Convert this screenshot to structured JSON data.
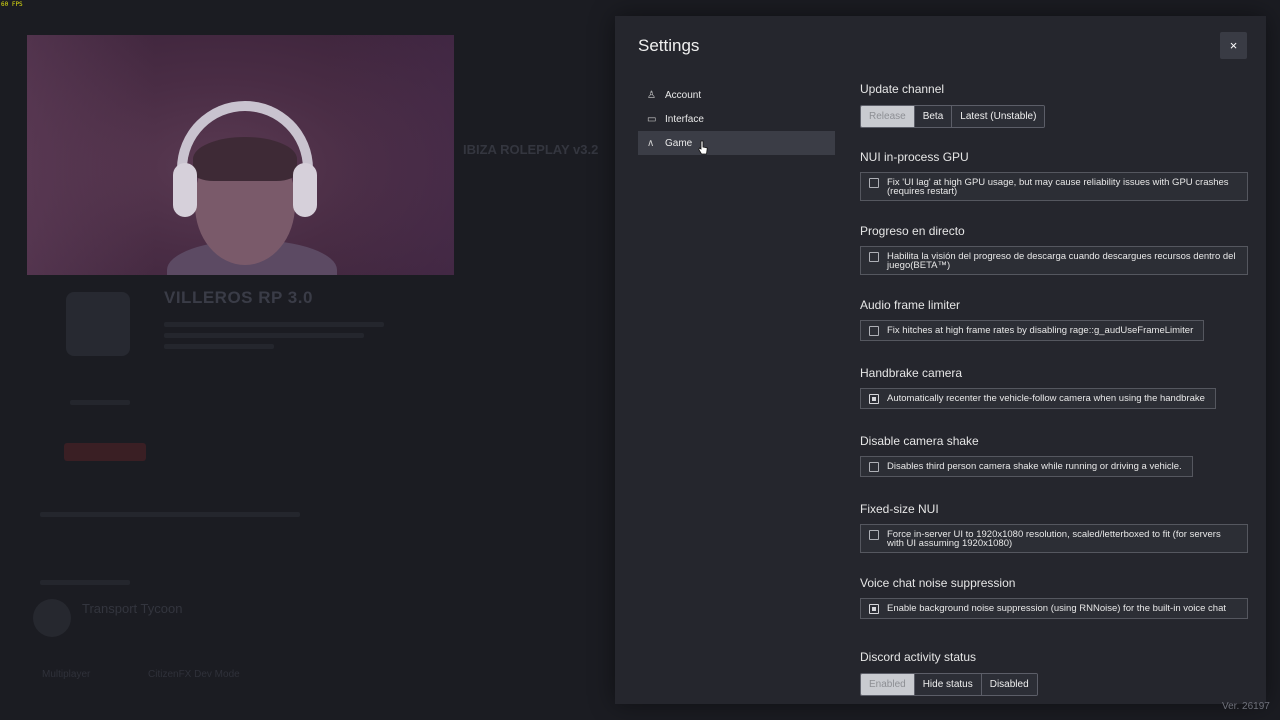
{
  "fps": "60 FPS",
  "background": {
    "server_title": "VILLEROS RP 3.0",
    "ibiza": "IBIZA ROLEPLAY v3.2",
    "transport": "Transport Tycoon",
    "footer_left": "Multiplayer",
    "footer_right": "CitizenFX Dev Mode"
  },
  "settings": {
    "title": "Settings",
    "close_icon": "×",
    "nav": [
      {
        "icon": "♙",
        "label": "Account"
      },
      {
        "icon": "▭",
        "label": "Interface"
      },
      {
        "icon": "∧",
        "label": "Game"
      }
    ],
    "update_channel": {
      "title": "Update channel",
      "options": [
        "Release",
        "Beta",
        "Latest (Unstable)"
      ],
      "selected": "Release"
    },
    "nui_gpu": {
      "title": "NUI in-process GPU",
      "text": "Fix 'UI lag' at high GPU usage, but may cause reliability issues with GPU crashes (requires restart)",
      "checked": false
    },
    "progreso": {
      "title": "Progreso en directo",
      "text": "Habilita la visión del progreso de descarga cuando descargues recursos dentro del juego(BETA™)",
      "checked": false
    },
    "audio": {
      "title": "Audio frame limiter",
      "text": "Fix hitches at high frame rates by disabling rage::g_audUseFrameLimiter",
      "checked": false
    },
    "handbrake": {
      "title": "Handbrake camera",
      "text": "Automatically recenter the vehicle-follow camera when using the handbrake",
      "checked": true
    },
    "shake": {
      "title": "Disable camera shake",
      "text": "Disables third person camera shake while running or driving a vehicle.",
      "checked": false
    },
    "fixed_nui": {
      "title": "Fixed-size NUI",
      "text": "Force in-server UI to 1920x1080 resolution, scaled/letterboxed to fit (for servers with UI assuming 1920x1080)",
      "checked": false
    },
    "voice": {
      "title": "Voice chat noise suppression",
      "text": "Enable background noise suppression (using RNNoise) for the built-in voice chat",
      "checked": true
    },
    "discord": {
      "title": "Discord activity status",
      "options": [
        "Enabled",
        "Hide status",
        "Disabled"
      ],
      "selected": "Enabled"
    }
  },
  "version": "Ver. 26197"
}
